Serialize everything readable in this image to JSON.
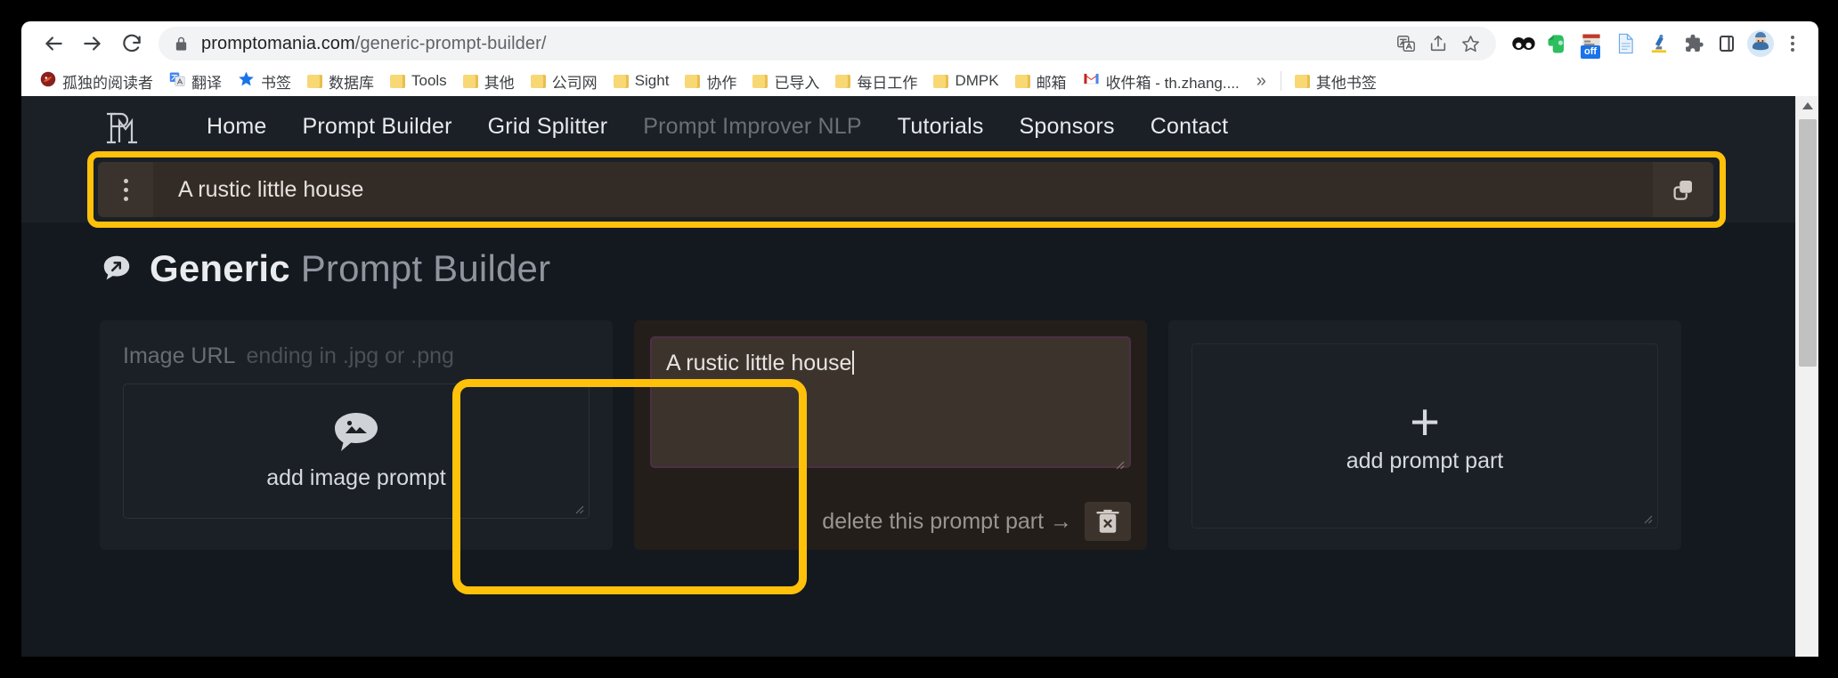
{
  "browser": {
    "back_label": "Back",
    "forward_label": "Forward",
    "reload_label": "Reload",
    "lock_label": "View site information",
    "url_domain": "promptomania.com",
    "url_path": "/generic-prompt-builder/",
    "omnibox_icons": [
      "translate-icon",
      "share-icon",
      "bookmark-star-icon"
    ],
    "extension_icons": [
      "glasses-icon",
      "evernote-icon",
      "adblock-off-icon",
      "document-icon",
      "microscope-icon",
      "puzzle-extensions-icon",
      "sidepanel-icon",
      "profile-avatar"
    ],
    "adblock_badge": "off",
    "menu_label": "Customize and control Google Chrome"
  },
  "bookmarks": {
    "items": [
      {
        "label": "孤独的阅读者",
        "icon": "site-favicon"
      },
      {
        "label": "翻译",
        "icon": "google-translate-icon"
      },
      {
        "label": "书签",
        "icon": "blue-star-icon"
      },
      {
        "label": "数据库",
        "icon": "folder-icon"
      },
      {
        "label": "Tools",
        "icon": "folder-icon"
      },
      {
        "label": "其他",
        "icon": "folder-icon"
      },
      {
        "label": "公司网",
        "icon": "folder-icon"
      },
      {
        "label": "Sight",
        "icon": "folder-icon"
      },
      {
        "label": "协作",
        "icon": "folder-icon"
      },
      {
        "label": "已导入",
        "icon": "folder-icon"
      },
      {
        "label": "每日工作",
        "icon": "folder-icon"
      },
      {
        "label": "DMPK",
        "icon": "folder-icon"
      },
      {
        "label": "邮箱",
        "icon": "folder-icon"
      },
      {
        "label": "收件箱 - th.zhang....",
        "icon": "gmail-icon"
      }
    ],
    "overflow_label": "»",
    "other_bookmarks": {
      "label": "其他书签",
      "icon": "folder-icon"
    }
  },
  "site": {
    "logo_label": "promptoMANIA",
    "nav": [
      {
        "label": "Home",
        "muted": false
      },
      {
        "label": "Prompt Builder",
        "muted": false
      },
      {
        "label": "Grid Splitter",
        "muted": false
      },
      {
        "label": "Prompt Improver NLP",
        "muted": true
      },
      {
        "label": "Tutorials",
        "muted": false
      },
      {
        "label": "Sponsors",
        "muted": false
      },
      {
        "label": "Contact",
        "muted": false
      }
    ]
  },
  "prompt_bar": {
    "drag_handle_label": "drag handle",
    "value": "A rustic little house",
    "copy_label": "copy prompt"
  },
  "page_title": {
    "icon": "speech-bubble-arrow-icon",
    "bold": "Generic",
    "light": "Prompt Builder"
  },
  "cards": {
    "image_prompt": {
      "field_label": "Image URL",
      "field_hint": "ending in .jpg or .png",
      "dropzone_label": "add image prompt",
      "dropzone_icon": "image-bubble-icon"
    },
    "prompt_part": {
      "textarea_value": "A rustic little house",
      "delete_label": "delete this prompt part →",
      "delete_icon": "trash-x-icon"
    },
    "add_part": {
      "plus": "+",
      "label": "add prompt part",
      "icon": "plus-icon"
    }
  },
  "highlights": {
    "color": "#ffc10a",
    "targets": [
      "prompt-bar",
      "prompt-part-card"
    ]
  },
  "scrollbar": {
    "up_arrow_label": "scroll up"
  }
}
